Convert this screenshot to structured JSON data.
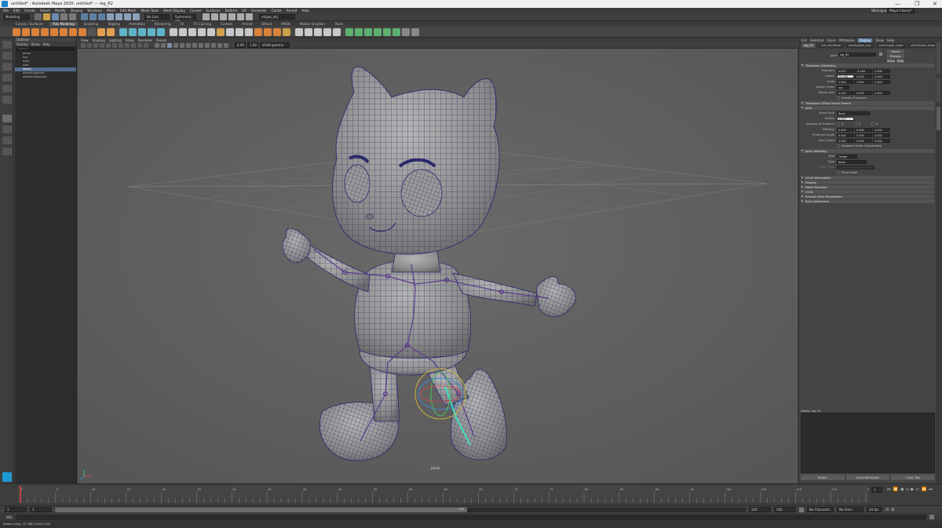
{
  "window": {
    "title": "untitled* - Autodesk Maya 2020: untitled*   ---   leg_R2",
    "minimize": "—",
    "maximize": "❐",
    "close": "✕"
  },
  "menubar": [
    "File",
    "Edit",
    "Create",
    "Select",
    "Modify",
    "Display",
    "Windows",
    "Mesh",
    "Edit Mesh",
    "Mesh Tools",
    "Mesh Display",
    "Curves",
    "Surfaces",
    "Deform",
    "UV",
    "Generate",
    "Cache",
    "Arnold",
    "Help"
  ],
  "workspace": {
    "label": "Workspace:",
    "value": "Maya Classic*"
  },
  "statusline": {
    "mode": "Modeling",
    "surface": "No Live Surface",
    "symmetry": "Symmetry: Off",
    "object": "mtype_obj"
  },
  "shelf_tabs": [
    "Curves / Surfaces",
    "Poly Modeling",
    "Sculpting",
    "Rigging",
    "Animation",
    "Rendering",
    "FX",
    "FX Caching",
    "Custom",
    "Arnold",
    "Bifrost",
    "MASH",
    "Motion Graphics",
    "XGen"
  ],
  "shelf_active": "Poly Modeling",
  "outliner": {
    "title": "Outliner",
    "menu": [
      "Display",
      "Show",
      "Help"
    ],
    "search_placeholder": "Search...",
    "items": [
      {
        "label": "persp",
        "selected": false
      },
      {
        "label": "top",
        "selected": false
      },
      {
        "label": "front",
        "selected": false
      },
      {
        "label": "side",
        "selected": false
      },
      {
        "label": "Model",
        "selected": true
      },
      {
        "label": "defaultLightSet",
        "selected": false
      },
      {
        "label": "defaultObjectSet",
        "selected": false
      }
    ]
  },
  "viewport": {
    "menu": [
      "View",
      "Shading",
      "Lighting",
      "Show",
      "Renderer",
      "Panels"
    ],
    "camera_label": "persp",
    "colorspace": "sRGB gamma",
    "field1": "0.00",
    "field2": "1.00"
  },
  "attr_editor": {
    "menu": [
      "List",
      "Selected",
      "Focus",
      "Attributes",
      "Display",
      "Show",
      "Help"
    ],
    "active_menu": "Display",
    "tabs": [
      "leg_R2",
      "hair_bindPose",
      "hairSystem_eye",
      "skinCluster_head",
      "skinCluster_body"
    ],
    "node_label": "joint:",
    "node_name": "leg_R2",
    "buttons": [
      "Focus",
      "Presets",
      "Show",
      "Hide"
    ],
    "section_transform": "Transform Attributes",
    "translate": {
      "label": "Translate",
      "values": [
        "0.872",
        "-3.499",
        "0.096"
      ]
    },
    "rotate": {
      "label": "Rotate",
      "values": [
        "75.786",
        "0.000",
        "0.000"
      ]
    },
    "scale": {
      "label": "Scale",
      "values": [
        "1.000",
        "1.000",
        "1.000"
      ]
    },
    "rotate_order": {
      "label": "Rotate Order",
      "value": "xyz"
    },
    "rotate_axis": {
      "label": "Rotate Axis",
      "values": [
        "0.000",
        "0.000",
        "0.000"
      ]
    },
    "inherits": "Inherits Transform",
    "section_offset": "Transform Offset Parent Matrix",
    "section_joint": "Joint",
    "draw_style": {
      "label": "Draw Style",
      "value": "Bone"
    },
    "radius": {
      "label": "Radius",
      "value": "0.500"
    },
    "dof": {
      "label": "Degrees of Freedom",
      "options": [
        "X",
        "Y",
        "Z"
      ]
    },
    "stiffness": {
      "label": "Stiffness",
      "values": [
        "0.000",
        "0.000",
        "0.000"
      ]
    },
    "preferred": {
      "label": "Preferred Angle",
      "values": [
        "0.000",
        "0.000",
        "0.000"
      ]
    },
    "joint_orient": {
      "label": "Joint Orient",
      "values": [
        "0.000",
        "0.000",
        "0.000"
      ]
    },
    "segment_scale": "Segment Scale Compensate",
    "section_labelling": "Joint Labelling",
    "side": {
      "label": "Side",
      "value": "Center"
    },
    "type": {
      "label": "Type",
      "value": "None"
    },
    "other_type": {
      "label": "Other Type",
      "value": ""
    },
    "draw_label": "Draw Label",
    "sections_closed": [
      "Limit Information",
      "Display",
      "Node Behavior",
      "UUID",
      "Smooth Skin Parameters",
      "Extra Attributes"
    ],
    "notes_label": "Notes: leg_R2",
    "bottom_buttons": [
      "Select",
      "Load Attributes",
      "Copy Tab"
    ]
  },
  "timeline": {
    "ticks": [
      "0",
      "5",
      "10",
      "15",
      "20",
      "25",
      "30",
      "35",
      "40",
      "45",
      "50",
      "55",
      "60",
      "65",
      "70",
      "75",
      "80",
      "85",
      "90",
      "95",
      "100",
      "105",
      "110",
      "115",
      "120"
    ],
    "current_frame": "1",
    "range_start": "1",
    "range_inner_start": "1",
    "range_inner_end": "120",
    "range_end": "120",
    "range_label": "120",
    "playback_end": "200",
    "character_set": "No Character Set",
    "anim_layer": "No Anim Layer",
    "fps": "24 fps"
  },
  "command": {
    "label": "MEL",
    "help": "Rotate (deg):  75.786     0.000     0.000"
  }
}
